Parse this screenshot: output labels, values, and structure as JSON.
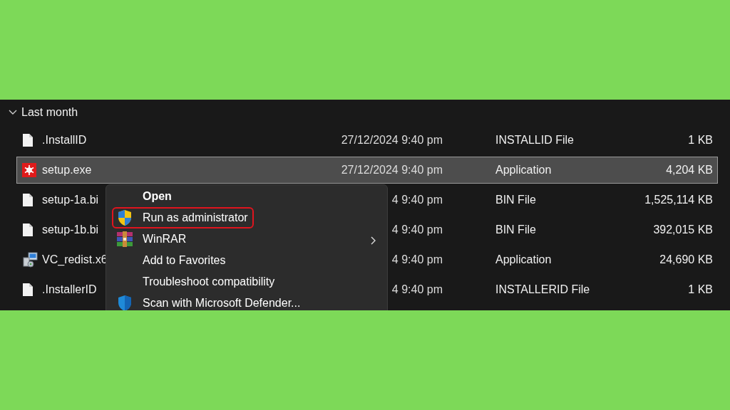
{
  "group": {
    "label": "Last month",
    "expanded": true
  },
  "files": [
    {
      "name": ".InstallID",
      "kind": "file",
      "date": "27/12/2024 9:40 pm",
      "type": "INSTALLID File",
      "size": "1 KB",
      "selected": false
    },
    {
      "name": "setup.exe",
      "kind": "app",
      "date": "27/12/2024 9:40 pm",
      "type": "Application",
      "size": "4,204 KB",
      "selected": true
    },
    {
      "name": "setup-1a.bi",
      "kind": "file",
      "date": "4 9:40 pm",
      "type": "BIN File",
      "size": "1,525,114 KB",
      "selected": false
    },
    {
      "name": "setup-1b.bi",
      "kind": "file",
      "date": "4 9:40 pm",
      "type": "BIN File",
      "size": "392,015 KB",
      "selected": false
    },
    {
      "name": "VC_redist.x6",
      "kind": "installer",
      "date": "4 9:40 pm",
      "type": "Application",
      "size": "24,690 KB",
      "selected": false
    },
    {
      "name": ".InstallerID",
      "kind": "file",
      "date": "4 9:40 pm",
      "type": "INSTALLERID File",
      "size": "1 KB",
      "selected": false
    }
  ],
  "context_menu": [
    {
      "label": "Open",
      "kind": "plain",
      "bold": true,
      "submenu": false,
      "highlighted": false
    },
    {
      "label": "Run as administrator",
      "kind": "elevated",
      "bold": false,
      "submenu": false,
      "highlighted": true
    },
    {
      "label": "WinRAR",
      "kind": "archiver",
      "bold": false,
      "submenu": true,
      "highlighted": false
    },
    {
      "label": "Add to Favorites",
      "kind": "plain",
      "bold": false,
      "submenu": false,
      "highlighted": false
    },
    {
      "label": "Troubleshoot compatibility",
      "kind": "plain",
      "bold": false,
      "submenu": false,
      "highlighted": false
    },
    {
      "label": "Scan with Microsoft Defender...",
      "kind": "scan",
      "bold": false,
      "submenu": false,
      "highlighted": false
    }
  ]
}
